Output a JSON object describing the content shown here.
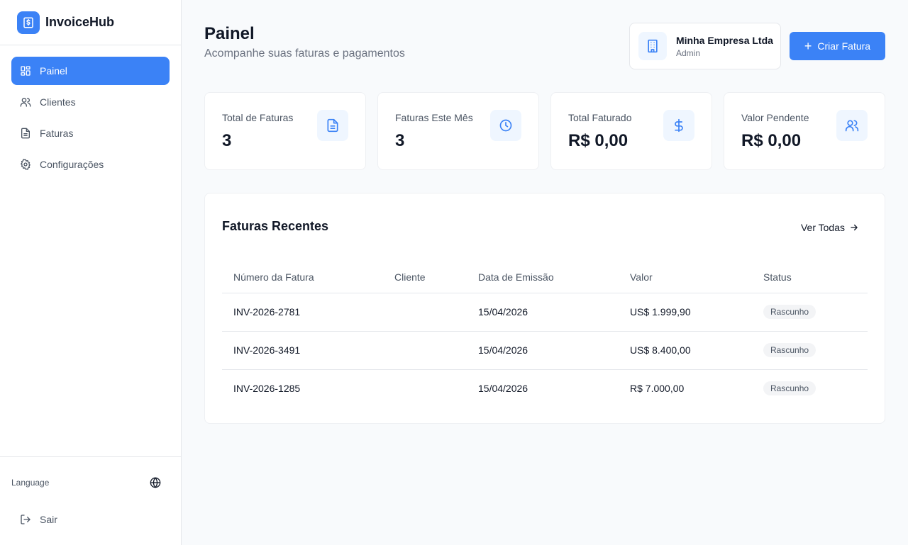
{
  "brand": {
    "name": "InvoiceHub",
    "icon": "invoice-dollar-icon"
  },
  "sidebar": {
    "items": [
      {
        "label": "Painel",
        "icon": "dashboard-grid-icon",
        "active": true
      },
      {
        "label": "Clientes",
        "icon": "users-icon",
        "active": false
      },
      {
        "label": "Faturas",
        "icon": "document-icon",
        "active": false
      },
      {
        "label": "Configurações",
        "icon": "gear-icon",
        "active": false
      }
    ],
    "language_label": "Language",
    "language_icon": "globe-icon",
    "logout_label": "Sair",
    "logout_icon": "logout-icon"
  },
  "header": {
    "title": "Painel",
    "subtitle": "Acompanhe suas faturas e pagamentos",
    "company": {
      "name": "Minha Empresa Ltda",
      "role": "Admin",
      "icon": "building-icon"
    },
    "create_label": "Criar Fatura"
  },
  "stats": [
    {
      "label": "Total de Faturas",
      "value": "3",
      "icon": "document-icon"
    },
    {
      "label": "Faturas Este Mês",
      "value": "3",
      "icon": "clock-icon"
    },
    {
      "label": "Total Faturado",
      "value": "R$ 0,00",
      "icon": "dollar-icon"
    },
    {
      "label": "Valor Pendente",
      "value": "R$ 0,00",
      "icon": "users-icon"
    }
  ],
  "recent": {
    "title": "Faturas Recentes",
    "see_all": "Ver Todas",
    "columns": [
      "Número da Fatura",
      "Cliente",
      "Data de Emissão",
      "Valor",
      "Status"
    ],
    "rows": [
      {
        "number": "INV-2026-2781",
        "client": "",
        "date": "15/04/2026",
        "amount": "US$ 1.999,90",
        "status": "Rascunho"
      },
      {
        "number": "INV-2026-3491",
        "client": "",
        "date": "15/04/2026",
        "amount": "US$ 8.400,00",
        "status": "Rascunho"
      },
      {
        "number": "INV-2026-1285",
        "client": "",
        "date": "15/04/2026",
        "amount": "R$ 7.000,00",
        "status": "Rascunho"
      }
    ]
  },
  "colors": {
    "accent": "#3b82f6",
    "accent_light": "#eff6ff"
  }
}
